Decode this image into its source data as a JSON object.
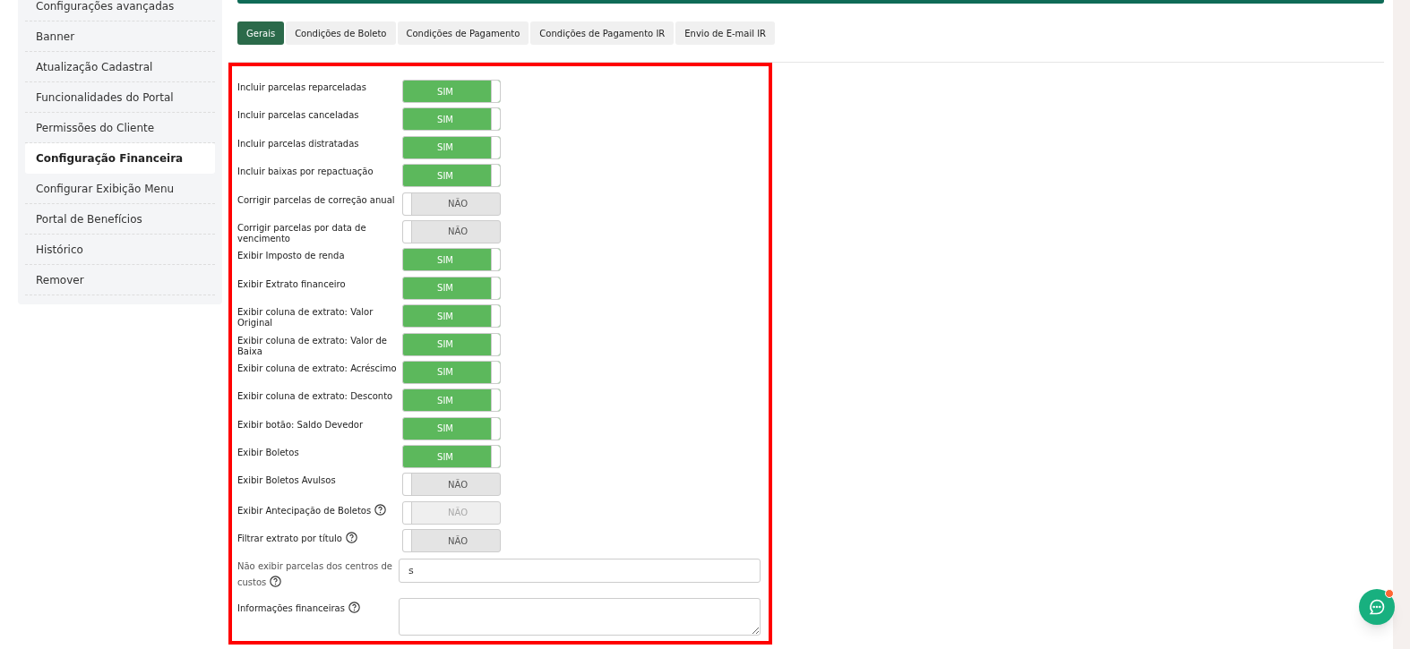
{
  "sidebar": {
    "items": [
      {
        "label": "Configurações avançadas",
        "selected": false
      },
      {
        "label": "Banner",
        "selected": false
      },
      {
        "label": "Atualização Cadastral",
        "selected": false
      },
      {
        "label": "Funcionalidades do Portal",
        "selected": false
      },
      {
        "label": "Permissões do Cliente",
        "selected": false
      },
      {
        "label": "Configuração Financeira",
        "selected": true
      },
      {
        "label": "Configurar Exibição Menu",
        "selected": false
      },
      {
        "label": "Portal de Benefícios",
        "selected": false
      },
      {
        "label": "Histórico",
        "selected": false
      },
      {
        "label": "Remover",
        "selected": false
      }
    ]
  },
  "tabs": [
    {
      "label": "Gerais",
      "selected": true
    },
    {
      "label": "Condições de Boleto",
      "selected": false
    },
    {
      "label": "Condições de Pagamento",
      "selected": false
    },
    {
      "label": "Condições de Pagamento IR",
      "selected": false
    },
    {
      "label": "Envio de E-mail IR",
      "selected": false
    }
  ],
  "settings": [
    {
      "kind": "toggle",
      "label": "Incluir parcelas reparceladas",
      "on": true,
      "disabled": false,
      "state_text": "SIM"
    },
    {
      "kind": "toggle",
      "label": "Incluir parcelas canceladas",
      "on": true,
      "disabled": false,
      "state_text": "SIM"
    },
    {
      "kind": "toggle",
      "label": "Incluir parcelas distratadas",
      "on": true,
      "disabled": false,
      "state_text": "SIM"
    },
    {
      "kind": "toggle",
      "label": "Incluir baixas por repactuação",
      "on": true,
      "disabled": false,
      "state_text": "SIM"
    },
    {
      "kind": "toggle",
      "label": "Corrigir parcelas de correção anual",
      "on": false,
      "disabled": false,
      "state_text": "NÃO"
    },
    {
      "kind": "toggle",
      "label": "Corrigir parcelas por data de vencimento",
      "on": false,
      "disabled": false,
      "state_text": "NÃO"
    },
    {
      "kind": "toggle",
      "label": "Exibir Imposto de renda",
      "on": true,
      "disabled": false,
      "state_text": "SIM"
    },
    {
      "kind": "toggle",
      "label": "Exibir Extrato financeiro",
      "on": true,
      "disabled": false,
      "state_text": "SIM"
    },
    {
      "kind": "toggle",
      "label": "Exibir coluna de extrato: Valor Original",
      "on": true,
      "disabled": false,
      "state_text": "SIM"
    },
    {
      "kind": "toggle",
      "label": "Exibir coluna de extrato: Valor de Baixa",
      "on": true,
      "disabled": false,
      "state_text": "SIM"
    },
    {
      "kind": "toggle",
      "label": "Exibir coluna de extrato: Acréscimo",
      "on": true,
      "disabled": false,
      "state_text": "SIM"
    },
    {
      "kind": "toggle",
      "label": "Exibir coluna de extrato: Desconto",
      "on": true,
      "disabled": false,
      "state_text": "SIM"
    },
    {
      "kind": "toggle",
      "label": "Exibir botão: Saldo Devedor",
      "on": true,
      "disabled": false,
      "state_text": "SIM"
    },
    {
      "kind": "toggle",
      "label": "Exibir Boletos",
      "on": true,
      "disabled": false,
      "state_text": "SIM"
    },
    {
      "kind": "toggle",
      "label": "Exibir Boletos Avulsos",
      "on": false,
      "disabled": false,
      "state_text": "NÃO"
    },
    {
      "kind": "toggle",
      "label": "Exibir Antecipação de Boletos",
      "on": false,
      "disabled": true,
      "state_text": "NÃO",
      "help": true
    },
    {
      "kind": "toggle",
      "label": "Filtrar extrato por título",
      "on": false,
      "disabled": false,
      "state_text": "NÃO",
      "help": true
    },
    {
      "kind": "input",
      "label": "Não exibir parcelas dos centros de custos",
      "value": "s",
      "help": true
    },
    {
      "kind": "textarea",
      "label": "Informações financeiras",
      "help": true
    }
  ]
}
